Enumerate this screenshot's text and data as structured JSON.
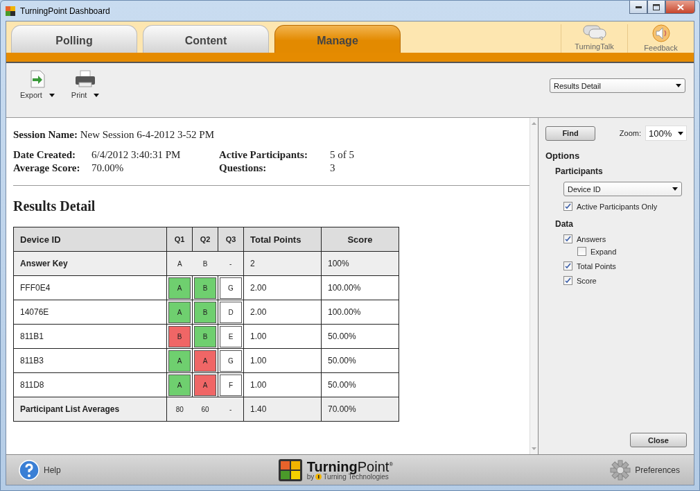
{
  "window": {
    "title": "TurningPoint Dashboard"
  },
  "tabs": [
    {
      "label": "Polling",
      "selected": false
    },
    {
      "label": "Content",
      "selected": false
    },
    {
      "label": "Manage",
      "selected": true
    }
  ],
  "top_links": [
    {
      "label": "TurningTalk",
      "kind": "chat"
    },
    {
      "label": "Feedback",
      "kind": "speaker"
    }
  ],
  "toolbar": {
    "buttons": [
      {
        "label": "Export",
        "kind": "export"
      },
      {
        "label": "Print",
        "kind": "print"
      }
    ],
    "view_select": "Results Detail"
  },
  "session": {
    "name_label": "Session Name:",
    "name": "New Session 6-4-2012 3-52 PM",
    "fields": [
      {
        "label": "Date Created:",
        "value": "6/4/2012 3:40:31 PM"
      },
      {
        "label": "Active Participants:",
        "value": "5 of 5"
      },
      {
        "label": "Average Score:",
        "value": "70.00%"
      },
      {
        "label": "Questions:",
        "value": "3"
      }
    ]
  },
  "report": {
    "title": "Results Detail",
    "columns": [
      "Device ID",
      "Q1",
      "Q2",
      "Q3",
      "Total Points",
      "Score"
    ],
    "rows": [
      {
        "kind": "summary",
        "device": "Answer Key",
        "answers": [
          {
            "text": "A"
          },
          {
            "text": "B"
          },
          {
            "text": "-"
          }
        ],
        "total": "2",
        "score": "100%"
      },
      {
        "kind": "participant",
        "device": "FFF0E4",
        "answers": [
          {
            "text": "A",
            "color": "#6fcf6f"
          },
          {
            "text": "B",
            "color": "#6fcf6f"
          },
          {
            "text": "G",
            "color": "#ffffff"
          }
        ],
        "total": "2.00",
        "score": "100.00%"
      },
      {
        "kind": "participant",
        "device": "14076E",
        "answers": [
          {
            "text": "A",
            "color": "#6fcf6f"
          },
          {
            "text": "B",
            "color": "#6fcf6f"
          },
          {
            "text": "D",
            "color": "#ffffff"
          }
        ],
        "total": "2.00",
        "score": "100.00%"
      },
      {
        "kind": "participant",
        "device": "811B1",
        "answers": [
          {
            "text": "B",
            "color": "#f06666"
          },
          {
            "text": "B",
            "color": "#6fcf6f"
          },
          {
            "text": "E",
            "color": "#ffffff"
          }
        ],
        "total": "1.00",
        "score": "50.00%"
      },
      {
        "kind": "participant",
        "device": "811B3",
        "answers": [
          {
            "text": "A",
            "color": "#6fcf6f"
          },
          {
            "text": "A",
            "color": "#f06666"
          },
          {
            "text": "G",
            "color": "#ffffff"
          }
        ],
        "total": "1.00",
        "score": "50.00%"
      },
      {
        "kind": "participant",
        "device": "811D8",
        "answers": [
          {
            "text": "A",
            "color": "#6fcf6f"
          },
          {
            "text": "A",
            "color": "#f06666"
          },
          {
            "text": "F",
            "color": "#ffffff"
          }
        ],
        "total": "1.00",
        "score": "50.00%"
      },
      {
        "kind": "summary",
        "device": "Participant List Averages",
        "answers": [
          {
            "text": "80"
          },
          {
            "text": "60"
          },
          {
            "text": "-"
          }
        ],
        "total": "1.40",
        "score": "70.00%"
      }
    ]
  },
  "side_panel": {
    "find_button": "Find",
    "zoom": {
      "label": "Zoom:",
      "value": "100%"
    },
    "options_title": "Options",
    "sections": [
      {
        "title": "Participants",
        "items": [
          {
            "kind": "select",
            "value": "Device ID"
          },
          {
            "kind": "checkbox",
            "label": "Active Participants Only",
            "checked": true
          }
        ]
      },
      {
        "title": "Data",
        "items": [
          {
            "kind": "checkbox",
            "label": "Answers",
            "checked": true,
            "children": [
              {
                "kind": "checkbox",
                "label": "Expand",
                "checked": false
              }
            ]
          },
          {
            "kind": "checkbox",
            "label": "Total Points",
            "checked": true
          },
          {
            "kind": "checkbox",
            "label": "Score",
            "checked": true
          }
        ]
      }
    ],
    "close_button": "Close"
  },
  "footer": {
    "help": "Help",
    "brand": "**Turning**Point$^{®}$",
    "by": "by",
    "company": "Turning Technologies",
    "preferences": "Preferences"
  }
}
